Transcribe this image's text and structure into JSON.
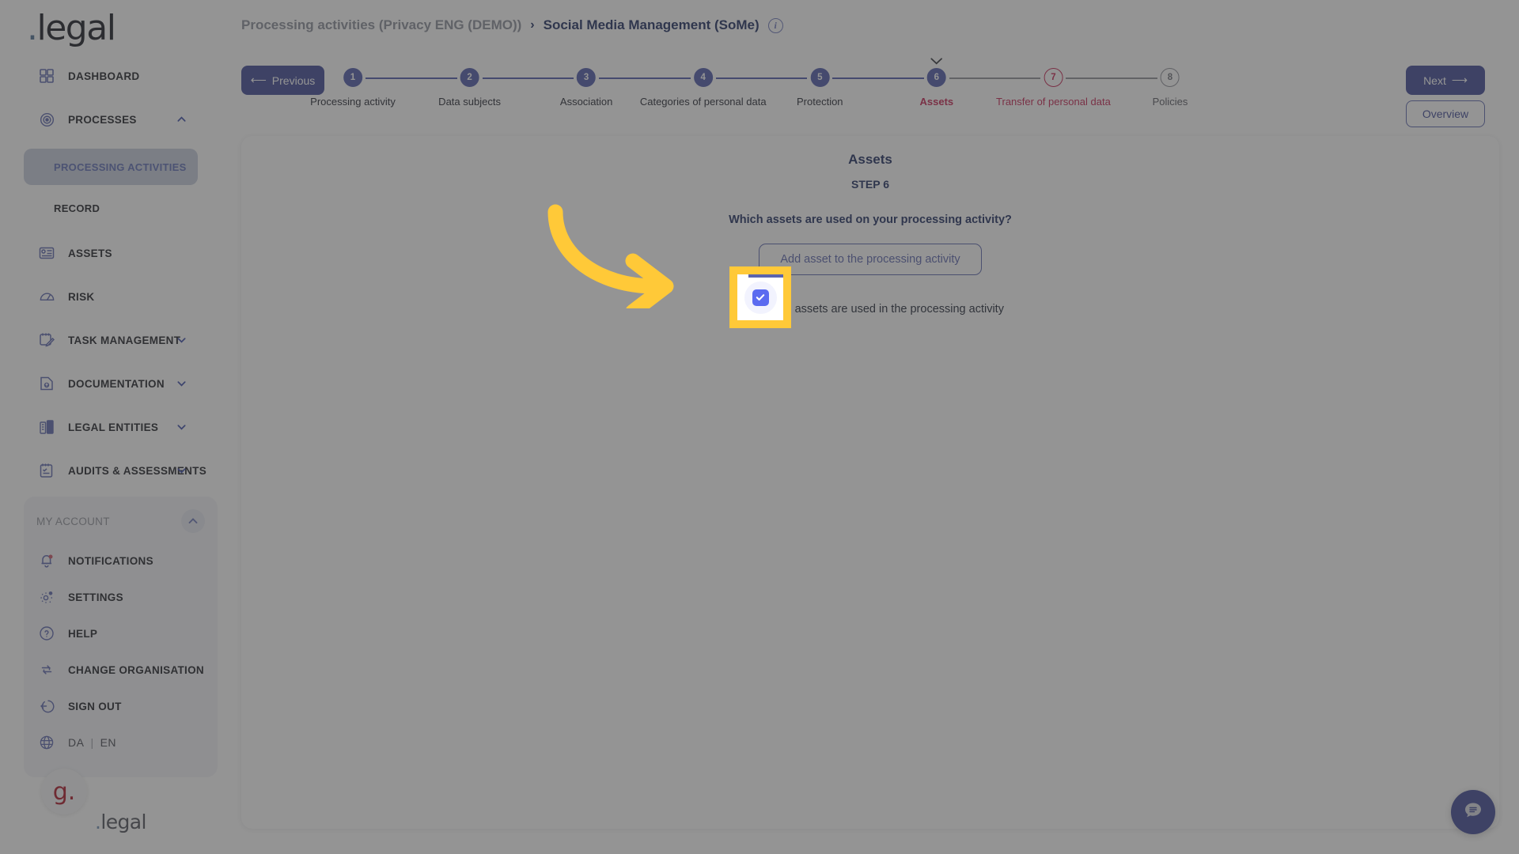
{
  "brand": {
    "name": "legal",
    "dot": "."
  },
  "sidebar": {
    "items": [
      {
        "label": "DASHBOARD",
        "icon": "grid-icon",
        "expandable": false
      },
      {
        "label": "PROCESSES",
        "icon": "process-icon",
        "expandable": true,
        "expanded": true
      },
      {
        "label": "ASSETS",
        "icon": "assets-icon",
        "expandable": false
      },
      {
        "label": "RISK",
        "icon": "gauge-icon",
        "expandable": false
      },
      {
        "label": "TASK MANAGEMENT",
        "icon": "task-icon",
        "expandable": true
      },
      {
        "label": "DOCUMENTATION",
        "icon": "document-icon",
        "expandable": true
      },
      {
        "label": "LEGAL ENTITIES",
        "icon": "building-icon",
        "expandable": true
      },
      {
        "label": "AUDITS & ASSESSMENTS",
        "icon": "clipboard-icon",
        "expandable": true
      }
    ],
    "sub_items": [
      {
        "label": "PROCESSING ACTIVITIES",
        "active": true
      },
      {
        "label": "RECORD",
        "active": false
      }
    ],
    "account": {
      "title": "MY ACCOUNT",
      "items": [
        {
          "label": "NOTIFICATIONS",
          "icon": "bell-icon",
          "badge": true
        },
        {
          "label": "SETTINGS",
          "icon": "gear-icon",
          "badge": true
        },
        {
          "label": "HELP",
          "icon": "question-icon",
          "badge": false
        },
        {
          "label": "CHANGE ORGANISATION",
          "icon": "swap-icon",
          "badge": false
        },
        {
          "label": "SIGN OUT",
          "icon": "signout-icon",
          "badge": false
        }
      ],
      "language": {
        "icon": "globe-icon",
        "da": "DA",
        "divider": "|",
        "en": "EN"
      }
    },
    "badge_letter": "g.",
    "footer_brand": "legal",
    "footer_dot": "."
  },
  "header": {
    "breadcrumb_prev": "Processing activities (Privacy ENG (DEMO))",
    "breadcrumb_sep": "›",
    "breadcrumb_current": "Social Media Management (SoMe)",
    "info_icon": "info-icon"
  },
  "toolbar": {
    "previous_label": "Previous",
    "previous_arrow": "⟵",
    "next_label": "Next",
    "next_arrow": "⟶",
    "overview_label": "Overview"
  },
  "stepper": {
    "steps": [
      {
        "number": "1",
        "caption": "Processing activity",
        "state": "done"
      },
      {
        "number": "2",
        "caption": "Data subjects",
        "state": "done"
      },
      {
        "number": "3",
        "caption": "Association",
        "state": "done"
      },
      {
        "number": "4",
        "caption": "Categories of personal data",
        "state": "done"
      },
      {
        "number": "5",
        "caption": "Protection",
        "state": "done"
      },
      {
        "number": "6",
        "caption": "Assets",
        "state": "current"
      },
      {
        "number": "7",
        "caption": "Transfer of personal data",
        "state": "warn"
      },
      {
        "number": "8",
        "caption": "Policies",
        "state": "todo"
      }
    ]
  },
  "content": {
    "title": "Assets",
    "step_label": "STEP 6",
    "question": "Which assets are used on your processing activity?",
    "add_button": "Add asset to the processing activity",
    "checkbox_label": "No assets are used in the processing activity",
    "checkbox_checked": true
  },
  "chat": {
    "icon": "chat-bubble-icon"
  },
  "annotation": {
    "arrow_color": "#FFC938",
    "highlight_color": "#FFC938",
    "target": "no-assets-checkbox"
  },
  "colors": {
    "primary": "#3C4694",
    "accent_blue": "#5B6BF0",
    "danger": "#C41E4E",
    "navy": "#1B2A5E",
    "highlight": "#FFC938"
  }
}
